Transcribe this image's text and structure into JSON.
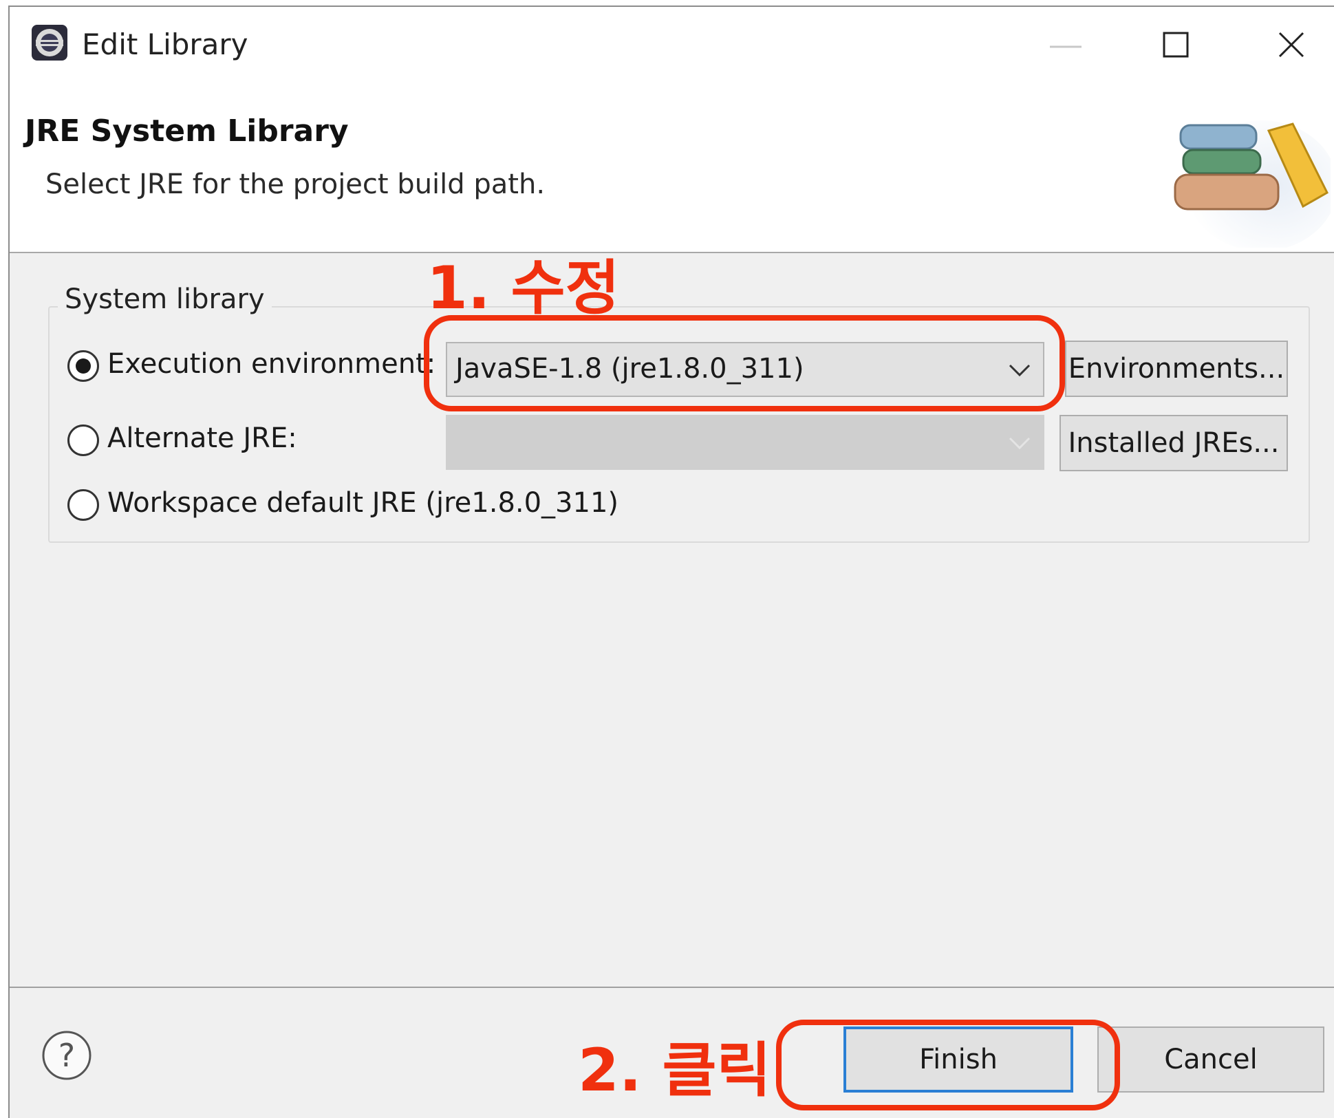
{
  "window": {
    "title": "Edit Library",
    "controls": {
      "minimize": "minimize",
      "maximize": "maximize",
      "close": "close"
    }
  },
  "header": {
    "title": "JRE System Library",
    "description": "Select JRE for the project build path.",
    "icon": "books-icon"
  },
  "system_library": {
    "group_label": "System library",
    "options": [
      {
        "label": "Execution environment:",
        "checked": true
      },
      {
        "label": "Alternate JRE:",
        "checked": false
      },
      {
        "label": "Workspace default JRE (jre1.8.0_311)",
        "checked": false
      }
    ],
    "execution_environment_value": "JavaSE-1.8 (jre1.8.0_311)",
    "alternate_jre_value": "",
    "environments_button": "Environments...",
    "installed_jres_button": "Installed JREs..."
  },
  "footer": {
    "help_icon": "help-icon",
    "finish_button": "Finish",
    "cancel_button": "Cancel"
  },
  "annotations": {
    "step1": "1. 수정",
    "step2": "2. 클릭",
    "color": "#f0300e"
  }
}
